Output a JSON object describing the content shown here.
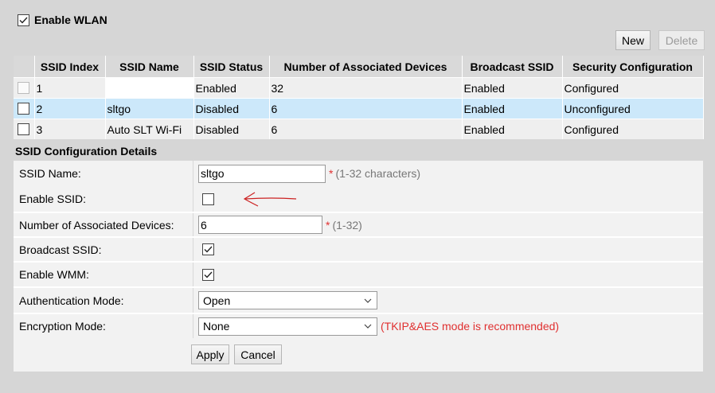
{
  "wlan": {
    "enable_label": "Enable WLAN",
    "enabled": true
  },
  "toolbar": {
    "new_label": "New",
    "delete_label": "Delete"
  },
  "table": {
    "headers": [
      "SSID Index",
      "SSID Name",
      "SSID Status",
      "Number of Associated Devices",
      "Broadcast SSID",
      "Security Configuration"
    ],
    "rows": [
      {
        "index": "1",
        "name": "",
        "status": "Enabled",
        "devices": "32",
        "broadcast": "Enabled",
        "security": "Configured",
        "selected": false
      },
      {
        "index": "2",
        "name": "sltgo",
        "status": "Disabled",
        "devices": "6",
        "broadcast": "Enabled",
        "security": "Unconfigured",
        "selected": true
      },
      {
        "index": "3",
        "name": "Auto SLT Wi-Fi",
        "status": "Disabled",
        "devices": "6",
        "broadcast": "Enabled",
        "security": "Configured",
        "selected": false
      }
    ]
  },
  "details": {
    "heading": "SSID Configuration Details",
    "ssid_name": {
      "label": "SSID Name:",
      "value": "sltgo",
      "required": "*",
      "hint": "(1-32 characters)"
    },
    "enable_ssid": {
      "label": "Enable SSID:",
      "checked": false
    },
    "devices": {
      "label": "Number of Associated Devices:",
      "value": "6",
      "required": "*",
      "hint": "(1-32)"
    },
    "broadcast": {
      "label": "Broadcast SSID:",
      "checked": true
    },
    "wmm": {
      "label": "Enable WMM:",
      "checked": true
    },
    "auth": {
      "label": "Authentication Mode:",
      "value": "Open"
    },
    "encryption": {
      "label": "Encryption Mode:",
      "value": "None",
      "note": "(TKIP&AES mode is recommended)"
    },
    "apply_label": "Apply",
    "cancel_label": "Cancel"
  },
  "annotation": {
    "color": "#cc2222",
    "icon": "red-arrow-pointing-left"
  }
}
